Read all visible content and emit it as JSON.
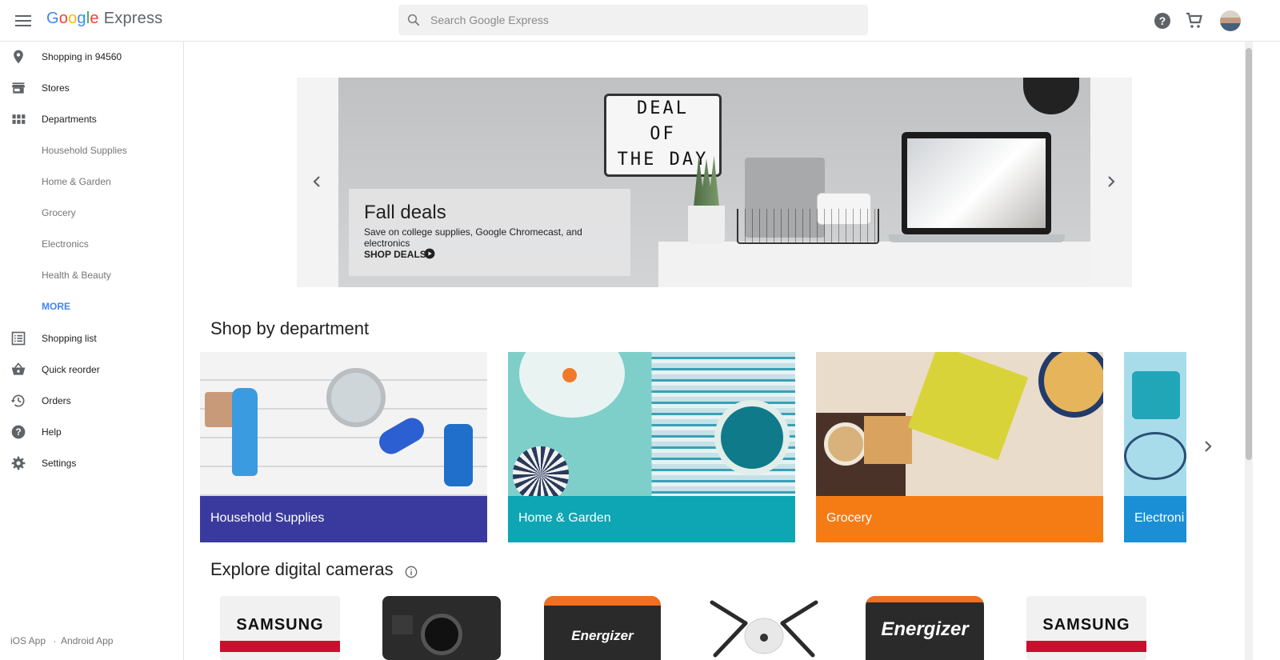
{
  "header": {
    "logo_google": "Google",
    "logo_express": "Express",
    "search_placeholder": "Search Google Express",
    "icons": [
      "menu-icon",
      "search-icon",
      "help-icon",
      "cart-icon",
      "avatar"
    ]
  },
  "sidebar": {
    "items": [
      {
        "label": "Shopping in 94560",
        "icon": "location-pin-icon"
      },
      {
        "label": "Stores",
        "icon": "store-icon"
      },
      {
        "label": "Departments",
        "icon": "grid-icon"
      },
      {
        "label": "Household Supplies"
      },
      {
        "label": "Home & Garden"
      },
      {
        "label": "Grocery"
      },
      {
        "label": "Electronics"
      },
      {
        "label": "Health & Beauty"
      },
      {
        "label": "MORE"
      },
      {
        "label": "Shopping list",
        "icon": "list-icon"
      },
      {
        "label": "Quick reorder",
        "icon": "basket-icon"
      },
      {
        "label": "Orders",
        "icon": "history-icon"
      },
      {
        "label": "Help",
        "icon": "help-icon"
      },
      {
        "label": "Settings",
        "icon": "gear-icon"
      }
    ],
    "footer": {
      "ios": "iOS App",
      "separator": "·",
      "android": "Android App"
    }
  },
  "hero": {
    "sign_lines": [
      "DEAL",
      "OF",
      "THE DAY"
    ],
    "title": "Fall deals",
    "subtitle": "Save on college supplies, Google Chromecast, and electronics",
    "cta": "SHOP DEALS"
  },
  "departments": {
    "title": "Shop by department",
    "cards": [
      {
        "label": "Household Supplies",
        "color": "#3a3a9e"
      },
      {
        "label": "Home & Garden",
        "color": "#0ea5b4"
      },
      {
        "label": "Grocery",
        "color": "#f57c15"
      },
      {
        "label": "Electroni",
        "color": "#1a8fd6"
      }
    ]
  },
  "cameras": {
    "title": "Explore digital cameras",
    "products": [
      {
        "brand": "SAMSUNG"
      },
      {
        "brand": ""
      },
      {
        "brand": "Energizer"
      },
      {
        "brand": ""
      },
      {
        "brand": "Energizer"
      },
      {
        "brand": "SAMSUNG"
      }
    ]
  },
  "colors": {
    "accent_blue": "#4285f4",
    "text": "#212121",
    "muted": "#757575"
  }
}
